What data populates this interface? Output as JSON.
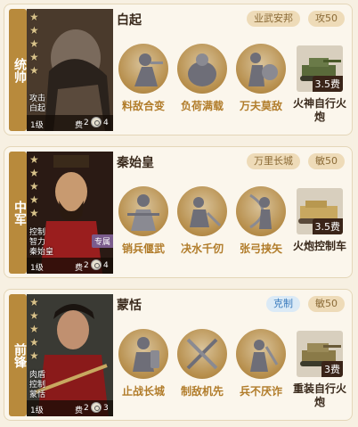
{
  "cards": [
    {
      "role": "统帅",
      "portrait_tags": [
        "攻击",
        "白起"
      ],
      "level": "1级",
      "cost_label": "费",
      "cost_value": "2",
      "cost_num": "4",
      "stars": [
        "★",
        "★",
        "★",
        "★",
        "★"
      ],
      "name": "白起",
      "tags": [
        "业武安邦",
        "攻50"
      ],
      "skills": [
        "料敌合变",
        "负荷满载",
        "万夫莫敌"
      ],
      "troop_name": "火神自行火炮",
      "troop_fee": "3.5费"
    },
    {
      "role": "中军",
      "portrait_tags": [
        "控制",
        "智力",
        "秦始皇"
      ],
      "badge": "专属",
      "level": "1级",
      "cost_label": "费",
      "cost_value": "2",
      "cost_num": "4",
      "stars": [
        "★",
        "★",
        "★",
        "★",
        "★"
      ],
      "name": "秦始皇",
      "tags": [
        "万里长城",
        "敏50"
      ],
      "skills": [
        "销兵偃武",
        "决水千仞",
        "张弓挟矢"
      ],
      "troop_name": "火炮控制车",
      "troop_fee": "3.5费"
    },
    {
      "role": "前锋",
      "portrait_tags": [
        "肉盾",
        "控制",
        "蒙恬"
      ],
      "level": "1级",
      "cost_label": "费",
      "cost_value": "2",
      "cost_num": "3",
      "stars": [
        "★",
        "★",
        "★",
        "★",
        "★"
      ],
      "name": "蒙恬",
      "tags": [
        "克制",
        "敏50"
      ],
      "skills": [
        "止战长城",
        "制敌机先",
        "兵不厌诈"
      ],
      "troop_name": "重装自行火炮",
      "troop_fee": "3费"
    }
  ],
  "colors": {
    "role_bg": "#b88a3c",
    "skill_text": "#b17c2a",
    "tag_gold_bg": "#eedbb8",
    "tag_blue_bg": "#dbeaf6"
  }
}
